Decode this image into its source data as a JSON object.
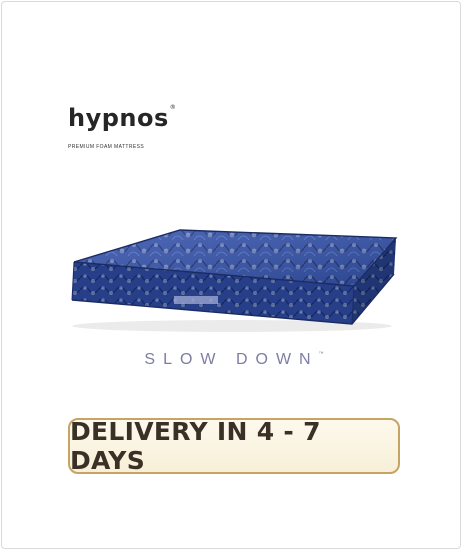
{
  "brand": {
    "name": "hypnos",
    "trademark": "®",
    "tagline": "PREMIUM FOAM MATTRESS"
  },
  "product": {
    "image_alt": "blue floral quilted foam mattress"
  },
  "slogan": {
    "text": "SLOW DOWN",
    "trademark": "™"
  },
  "badge": {
    "text": "DELIVERY IN 4 - 7 DAYS"
  },
  "colors": {
    "mattress_blue": "#2e4aa0",
    "slogan": "#7d7da3",
    "badge_border": "#c5a464",
    "badge_bg": "#f9f3e0",
    "badge_text": "#3a3026"
  }
}
